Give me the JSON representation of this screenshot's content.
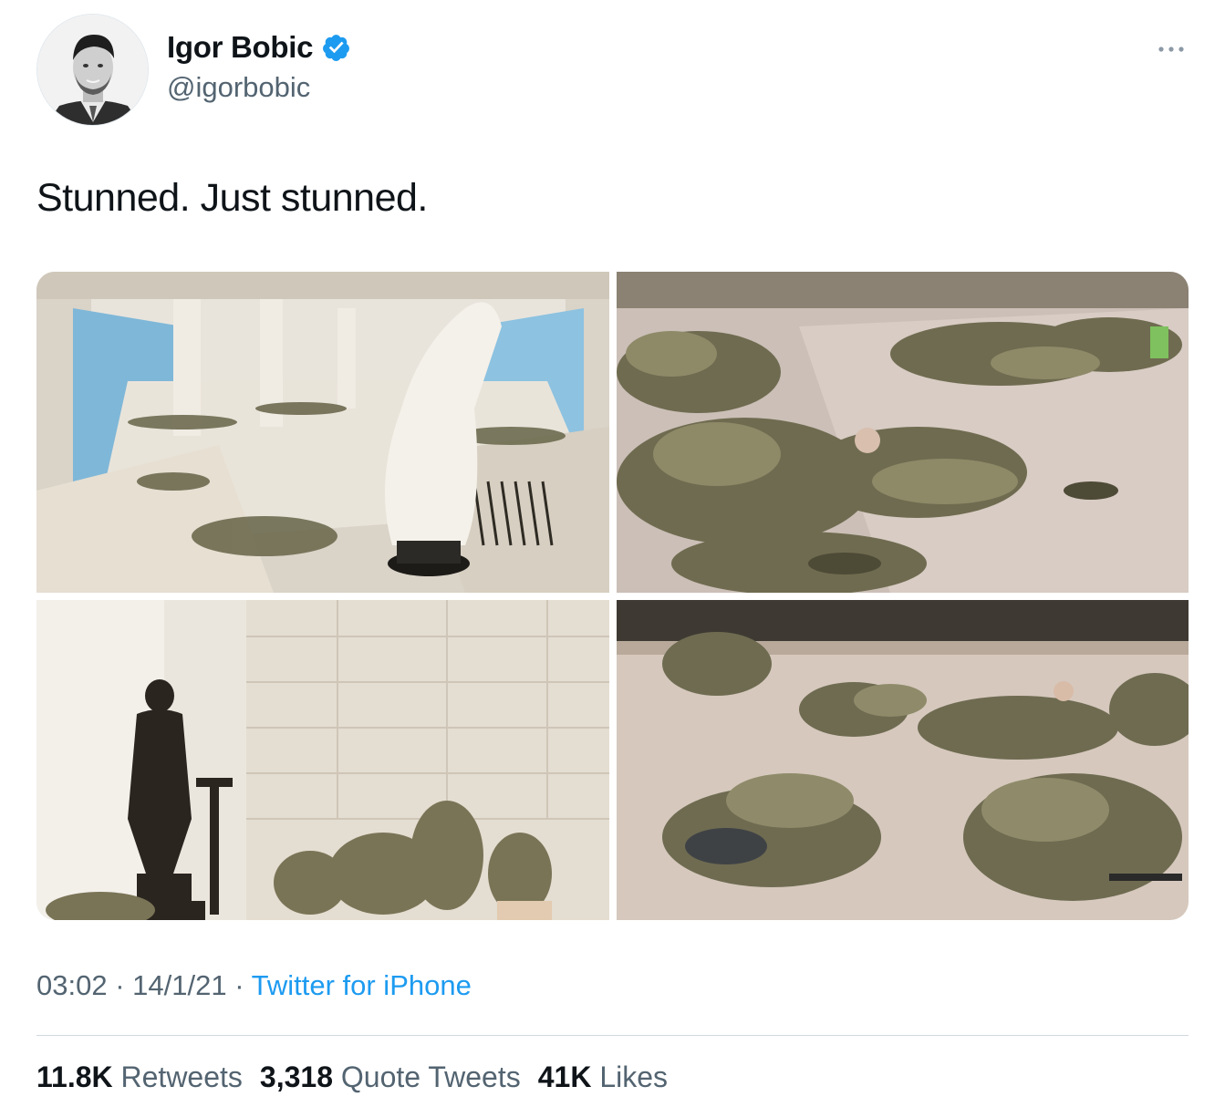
{
  "author": {
    "display_name": "Igor Bobic",
    "handle": "@igorbobic",
    "verified": true,
    "verified_color": "#1d9bf0"
  },
  "tweet": {
    "text": "Stunned. Just stunned."
  },
  "media": [
    {
      "icon": "photo-capitol-visitor-center-statue"
    },
    {
      "icon": "photo-soldiers-sleeping-on-floor"
    },
    {
      "icon": "photo-statue-and-soldiers"
    },
    {
      "icon": "photo-soldiers-resting-on-floor"
    }
  ],
  "meta": {
    "time": "03:02",
    "separator": "·",
    "date": "14/1/21",
    "source": "Twitter for iPhone"
  },
  "stats": {
    "retweets": {
      "count": "11.8K",
      "label": "Retweets"
    },
    "quote_tweets": {
      "count": "3,318",
      "label": "Quote Tweets"
    },
    "likes": {
      "count": "41K",
      "label": "Likes"
    }
  },
  "colors": {
    "text": "#0f1419",
    "secondary": "#536471",
    "link": "#1d9bf0",
    "divider": "#cfd9de"
  }
}
